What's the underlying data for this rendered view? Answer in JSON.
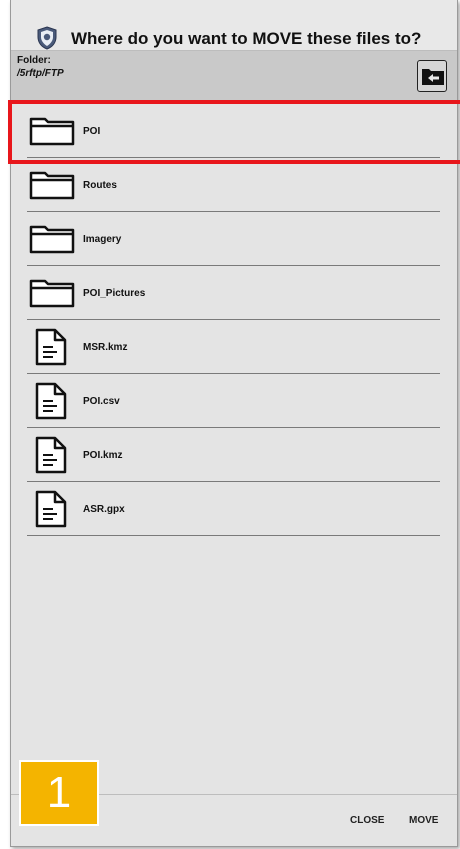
{
  "dialog": {
    "title": "Where do you want to MOVE these files to?",
    "app_icon": "shield-icon"
  },
  "folder": {
    "label": "Folder:",
    "path": "/5rftp/FTP",
    "up_icon": "folder-up-icon"
  },
  "items": [
    {
      "name": "POI",
      "type": "folder",
      "icon": "folder-icon"
    },
    {
      "name": "Routes",
      "type": "folder",
      "icon": "folder-icon"
    },
    {
      "name": "Imagery",
      "type": "folder",
      "icon": "folder-icon"
    },
    {
      "name": "POI_Pictures",
      "type": "folder",
      "icon": "folder-icon"
    },
    {
      "name": "MSR.kmz",
      "type": "file",
      "icon": "file-icon"
    },
    {
      "name": "POI.csv",
      "type": "file",
      "icon": "file-icon"
    },
    {
      "name": "POI.kmz",
      "type": "file",
      "icon": "file-icon"
    },
    {
      "name": "ASR.gpx",
      "type": "file",
      "icon": "file-icon"
    }
  ],
  "selected_item": "POI",
  "footer": {
    "close_label": "CLOSE",
    "move_label": "MOVE"
  },
  "step_badge": "1",
  "colors": {
    "highlight": "#e8161b",
    "badge": "#f4b400",
    "dialog_bg": "#e4e4e4",
    "folder_bar_bg": "#c9c9c9"
  }
}
